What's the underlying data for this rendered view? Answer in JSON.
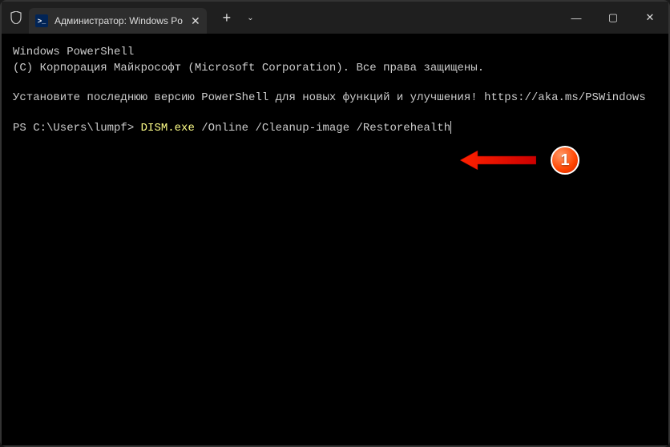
{
  "titlebar": {
    "tab_title": "Администратор: Windows Po",
    "new_tab_label": "+",
    "dropdown_label": "⌄"
  },
  "window_controls": {
    "minimize": "—",
    "maximize": "▢",
    "close": "✕"
  },
  "terminal": {
    "line1": "Windows PowerShell",
    "line2": "(C) Корпорация Майкрософт (Microsoft Corporation). Все права защищены.",
    "line3": "Установите последнюю версию PowerShell для новых функций и улучшения! https://aka.ms/PSWindows",
    "prompt": "PS C:\\Users\\lumpf> ",
    "command_executable": "DISM.exe",
    "command_args": " /Online /Cleanup-image /Restorehealth"
  },
  "annotation": {
    "badge_number": "1"
  }
}
